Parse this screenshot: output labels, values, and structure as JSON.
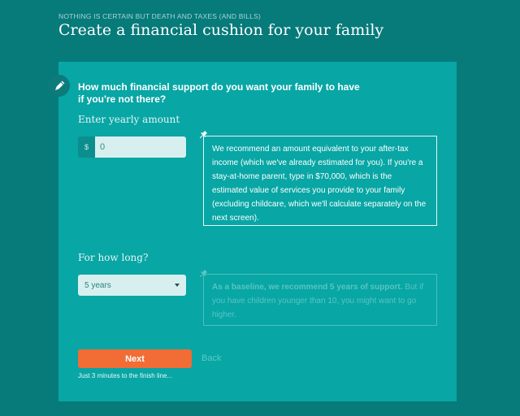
{
  "header": {
    "eyebrow": "NOTHING IS CERTAIN BUT DEATH AND TAXES (AND BILLS)",
    "title": "Create a financial cushion for your family"
  },
  "form": {
    "question_line1": "How much financial support do you want your family to have",
    "question_line2": "if you're not there?",
    "amount_label": "Enter yearly amount",
    "currency_symbol": "$",
    "amount_value": "0",
    "amount_tip": "We recommend an amount equivalent to your after-tax income (which we've already estimated for you). If you're a stay-at-home parent, type in $70,000, which is the estimated value of services you provide to your family (excluding childcare, which we'll calculate separately on the next screen).",
    "duration_label": "For how long?",
    "duration_value": "5 years",
    "duration_tip_bold": "As a baseline, we recommend 5 years of support.",
    "duration_tip_rest": " But if you have children younger than 10, you might want to go higher."
  },
  "actions": {
    "next_label": "Next",
    "back_label": "Back",
    "finish_note": "Just 3 minutes to the finish line..."
  },
  "icons": {
    "edit": "pencil-icon",
    "tip": "pushpin-icon",
    "dropdown": "caret-down-icon"
  },
  "colors": {
    "page_bg": "#077a7a",
    "card_bg": "#08a6a5",
    "accent": "#f26c36"
  }
}
